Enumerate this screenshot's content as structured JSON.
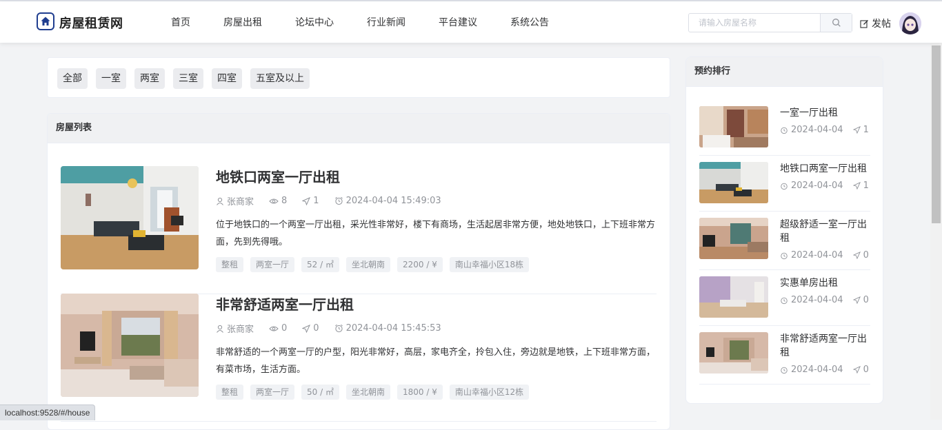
{
  "header": {
    "logo_text": "房屋租赁网",
    "nav": [
      "首页",
      "房屋出租",
      "论坛中心",
      "行业新闻",
      "平台建议",
      "系统公告"
    ],
    "search_placeholder": "请输入房屋名称",
    "post_label": "发帖"
  },
  "filters": [
    "全部",
    "一室",
    "两室",
    "三室",
    "四室",
    "五室及以上"
  ],
  "house_list": {
    "title": "房屋列表",
    "items": [
      {
        "title": "地铁口两室一厅出租",
        "author": "张商家",
        "views": "8",
        "likes": "1",
        "time": "2024-04-04 15:49:03",
        "desc": "位于地铁口的一个两室一厅出租，采光性非常好，楼下有商场，生活起居非常方便，地处地铁口，上下班非常方面，先到先得哦。",
        "tags": [
          "整租",
          "两室一厅",
          "52 / ㎡",
          "坐北朝南",
          "2200 / ¥",
          "南山幸福小区18栋"
        ]
      },
      {
        "title": "非常舒适两室一厅出租",
        "author": "张商家",
        "views": "0",
        "likes": "0",
        "time": "2024-04-04 15:45:53",
        "desc": "非常舒适的一个两室一厅的户型，阳光非常好，高层，家电齐全，拎包入住，旁边就是地铁，上下班非常方面，有菜市场，生活方面。",
        "tags": [
          "整租",
          "两室一厅",
          "50 / ㎡",
          "坐北朝南",
          "1800 / ¥",
          "南山幸福小区12栋"
        ]
      }
    ]
  },
  "ranking": {
    "title": "预约排行",
    "items": [
      {
        "title": "一室一厅出租",
        "date": "2024-04-04",
        "count": "1"
      },
      {
        "title": "地铁口两室一厅出租",
        "date": "2024-04-04",
        "count": "1"
      },
      {
        "title": "超级舒适一室一厅出租",
        "date": "2024-04-04",
        "count": "0"
      },
      {
        "title": "实惠单房出租",
        "date": "2024-04-04",
        "count": "0"
      },
      {
        "title": "非常舒适两室一厅出租",
        "date": "2024-04-04",
        "count": "0"
      }
    ]
  },
  "status_url": "localhost:9528/#/house",
  "colors": {
    "brand": "#1f3d8f",
    "muted": "#909399",
    "chip_bg": "#ebecef"
  }
}
